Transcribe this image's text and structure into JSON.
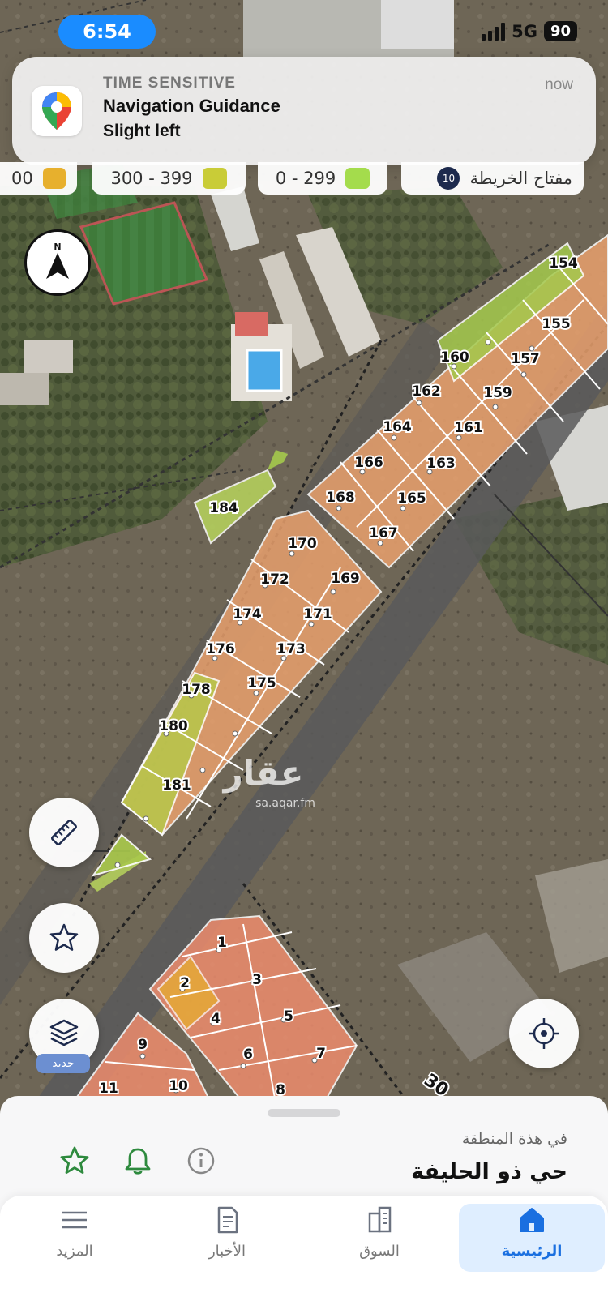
{
  "status_bar": {
    "time": "6:54",
    "network": "5G",
    "battery": "90"
  },
  "notification": {
    "kicker": "TIME SENSITIVE",
    "title": "Navigation Guidance",
    "body": "Slight left",
    "time": "now",
    "app_icon": "location-pin-icon"
  },
  "map_legend": {
    "key_label": "مفتاح الخريطة",
    "key_count": "10",
    "ranges": [
      {
        "label": "0 - 299",
        "color": "#a4dc4c"
      },
      {
        "label": "300 - 399",
        "color": "#c9cc37"
      },
      {
        "label": "00",
        "color": "#e7b02d"
      }
    ]
  },
  "plots": {
    "labels": [
      "154",
      "155",
      "157",
      "159",
      "160",
      "161",
      "162",
      "163",
      "164",
      "165",
      "166",
      "167",
      "168",
      "169",
      "170",
      "171",
      "172",
      "173",
      "174",
      "175",
      "176",
      "178",
      "180",
      "181",
      "184",
      "1",
      "2",
      "3",
      "4",
      "5",
      "6",
      "7",
      "8",
      "9",
      "10",
      "11"
    ]
  },
  "road_label": "30",
  "watermark": {
    "logo": "عقار",
    "site": "sa.aqar.fm"
  },
  "map_controls": {
    "compass_icon": "compass-icon",
    "measure_icon": "ruler-icon",
    "favorite_icon": "star-icon",
    "layers_icon": "layers-icon",
    "layers_badge": "جديد",
    "locate_icon": "target-icon"
  },
  "area_sheet": {
    "caption": "في هذة المنطقة",
    "name": "حي ذو الحليفة",
    "actions": [
      "star-icon",
      "bell-icon",
      "info-icon"
    ]
  },
  "tabbar": {
    "tabs": [
      {
        "label": "الرئيسية",
        "icon": "home-icon",
        "active": true
      },
      {
        "label": "السوق",
        "icon": "building-icon",
        "active": false
      },
      {
        "label": "الأخبار",
        "icon": "news-icon",
        "active": false
      },
      {
        "label": "المزيد",
        "icon": "menu-icon",
        "active": false
      }
    ]
  }
}
